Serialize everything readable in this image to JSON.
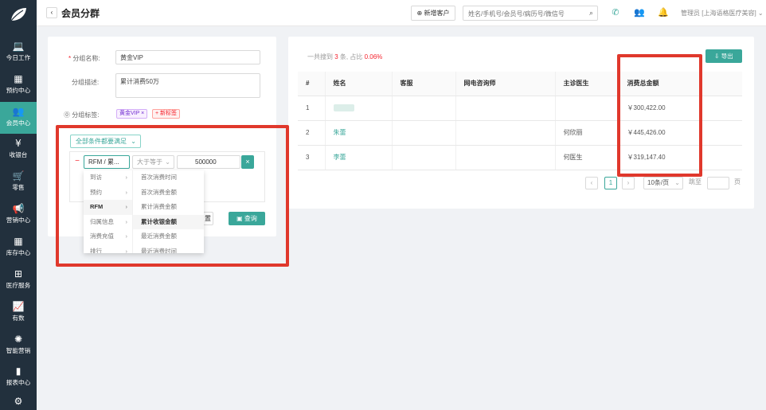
{
  "sidebar": {
    "items": [
      {
        "icon": "laptop-icon",
        "glyph": "💻",
        "label": "今日工作"
      },
      {
        "icon": "calendar-icon",
        "glyph": "▦",
        "label": "预约中心"
      },
      {
        "icon": "users-icon",
        "glyph": "👥",
        "label": "会员中心",
        "active": true
      },
      {
        "icon": "yen-icon",
        "glyph": "¥",
        "label": "收银台"
      },
      {
        "icon": "cart-icon",
        "glyph": "🛒",
        "label": "零售"
      },
      {
        "icon": "megaphone-icon",
        "glyph": "📢",
        "label": "营销中心"
      },
      {
        "icon": "grid-icon",
        "glyph": "▦",
        "label": "库存中心"
      },
      {
        "icon": "medkit-icon",
        "glyph": "⊞",
        "label": "医疗服务"
      },
      {
        "icon": "chart-line-icon",
        "glyph": "📈",
        "label": "有数"
      },
      {
        "icon": "brain-icon",
        "glyph": "✺",
        "label": "智能营销"
      },
      {
        "icon": "bar-chart-icon",
        "glyph": "▮",
        "label": "报表中心"
      },
      {
        "icon": "gear-icon",
        "glyph": "⚙",
        "label": ""
      }
    ]
  },
  "header": {
    "back": "‹",
    "title": "会员分群",
    "new_customer": "新增客户",
    "search_placeholder": "姓名/手机号/会员号/病历号/微信号",
    "admin": "管理员 [上海语格医疗美容]"
  },
  "form": {
    "name_label": "分组名称:",
    "name_value": "黄金VIP",
    "desc_label": "分组描述:",
    "desc_value": "累计消费50万",
    "tags_label": "分组标签:",
    "tag_vip": "黄金VIP ×",
    "tag_new": "+ 新标签",
    "condition_button": "全部条件都要满足",
    "field_select": "RFM / 累...",
    "operator_select": "大于等于",
    "amount_value": "500000",
    "query_button": "查询",
    "reset_button": "置"
  },
  "cascader": {
    "level1": [
      "到访",
      "预约",
      "RFM",
      "归属信息",
      "消费充值",
      "排行"
    ],
    "level2": [
      "首次消费时间",
      "首次消费金额",
      "累计消费金额",
      "累计收银金额",
      "最近消费金额",
      "最近消费时间"
    ]
  },
  "results": {
    "summary_prefix": "一共搜到",
    "summary_count": "3",
    "summary_mid": "条, 占比",
    "summary_ratio": "0.06%",
    "export_button": "导出",
    "columns": [
      "#",
      "姓名",
      "客服",
      "网电咨询师",
      "主诊医生",
      "消费总金额"
    ],
    "rows": [
      {
        "index": "1",
        "name": "",
        "service": "",
        "consultant": "",
        "doctor": "",
        "total": "￥300,422.00"
      },
      {
        "index": "2",
        "name": "朱蕾",
        "service": "",
        "consultant": "",
        "doctor": "何欣丽",
        "total": "￥445,426.00"
      },
      {
        "index": "3",
        "name": "李蕾",
        "service": "",
        "consultant": "",
        "doctor": "何医生",
        "total": "￥319,147.40"
      }
    ]
  },
  "pagination": {
    "current_page": "1",
    "page_size": "10条/页",
    "jump_label": "跳至",
    "page_suffix": "页"
  },
  "colors": {
    "sidebar": "#22303d",
    "accent": "#3aa79a",
    "highlight_box": "#e0382c"
  }
}
